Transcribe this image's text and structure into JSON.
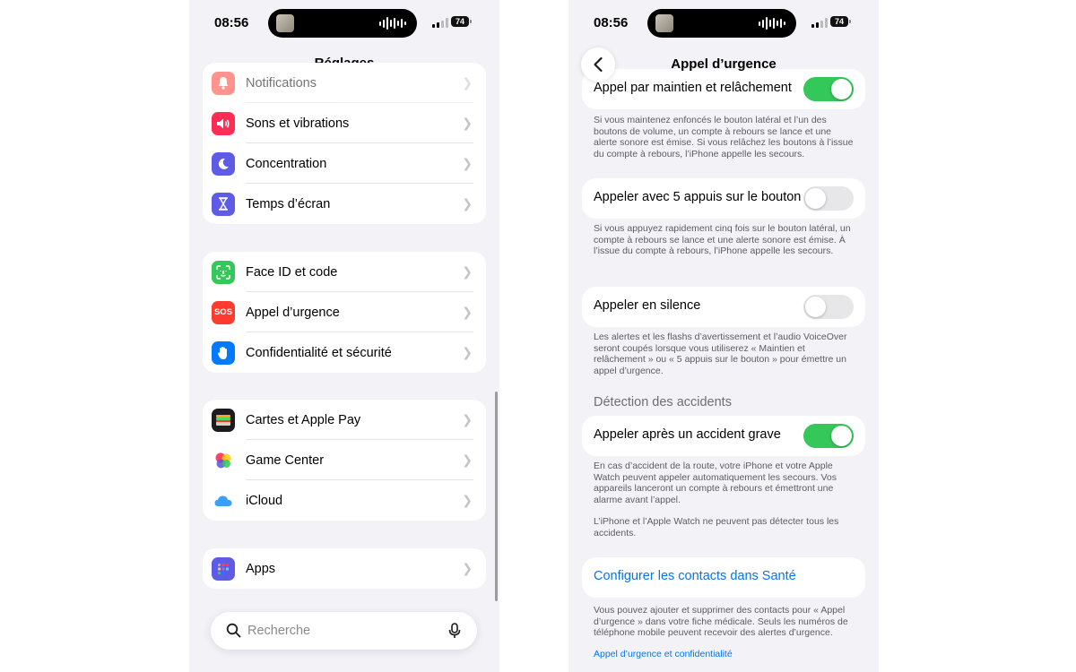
{
  "left_screen": {
    "status": {
      "time": "08:56",
      "battery": "74"
    },
    "title": "Réglages",
    "groups": [
      {
        "items": [
          {
            "label": "Notifications",
            "icon": "bell-icon",
            "color": "#ff3b30"
          },
          {
            "label": "Sons et vibrations",
            "icon": "speaker-icon",
            "color": "#ff2d55"
          },
          {
            "label": "Concentration",
            "icon": "moon-icon",
            "color": "#5e5ce6"
          },
          {
            "label": "Temps d’écran",
            "icon": "hourglass-icon",
            "color": "#5e5ce6"
          }
        ]
      },
      {
        "items": [
          {
            "label": "Face ID et code",
            "icon": "face-id-icon",
            "color": "#34c759"
          },
          {
            "label": "Appel d’urgence",
            "icon": "sos-icon",
            "icon_text": "SOS",
            "color": "#ff3b30"
          },
          {
            "label": "Confidentialité et sécurité",
            "icon": "hand-icon",
            "color": "#007aff"
          }
        ]
      },
      {
        "items": [
          {
            "label": "Cartes et Apple Pay",
            "icon": "wallet-icon",
            "color": "#1c1c1e"
          },
          {
            "label": "Game Center",
            "icon": "game-center-icon",
            "color": "#ffffff"
          },
          {
            "label": "iCloud",
            "icon": "cloud-icon",
            "color": "#ffffff"
          }
        ]
      },
      {
        "items": [
          {
            "label": "Apps",
            "icon": "apps-grid-icon",
            "color": "#5e5ce6"
          }
        ]
      }
    ],
    "search": {
      "placeholder": "Recherche"
    }
  },
  "right_screen": {
    "status": {
      "time": "08:56",
      "battery": "74"
    },
    "title": "Appel d’urgence",
    "settings": [
      {
        "label": "Appel par maintien et relâchement",
        "on": true,
        "footnote": "Si vous maintenez enfoncés le bouton latéral et l’un des boutons de volume, un compte à rebours se lance et une alerte sonore est émise. Si vous relâchez les boutons à l’issue du compte à rebours, l’iPhone appelle les secours."
      },
      {
        "label": "Appeler avec 5 appuis sur le bouton",
        "on": false,
        "footnote": "Si vous appuyez rapidement cinq fois sur le bouton latéral, un compte à rebours se lance et une alerte sonore est émise. À l’issue du compte à rebours, l’iPhone appelle les secours."
      },
      {
        "label": "Appeler en silence",
        "on": false,
        "footnote": "Les alertes et les flashs d’avertissement et l’audio VoiceOver seront coupés lorsque vous utiliserez « Maintien et relâchement » ou « 5 appuis sur le bouton » pour émettre un appel d’urgence."
      }
    ],
    "crash_section": {
      "header": "Détection des accidents",
      "label": "Appeler après un accident grave",
      "on": true,
      "footnote1": "En cas d’accident de la route, votre iPhone et votre Apple Watch peuvent appeler automatiquement les secours. Vos appareils lanceront un compte à rebours et émettront une alarme avant l’appel.",
      "footnote2": "L’iPhone et l’Apple Watch ne peuvent pas détecter tous les accidents."
    },
    "health_link": {
      "label": "Configurer les contacts dans Santé",
      "footnote": "Vous pouvez ajouter et supprimer des contacts pour « Appel d’urgence » dans votre fiche médicale. Seuls les numéros de téléphone mobile peuvent recevoir des alertes d’urgence.",
      "privacy_link": "Appel d’urgence et confidentialité"
    }
  }
}
